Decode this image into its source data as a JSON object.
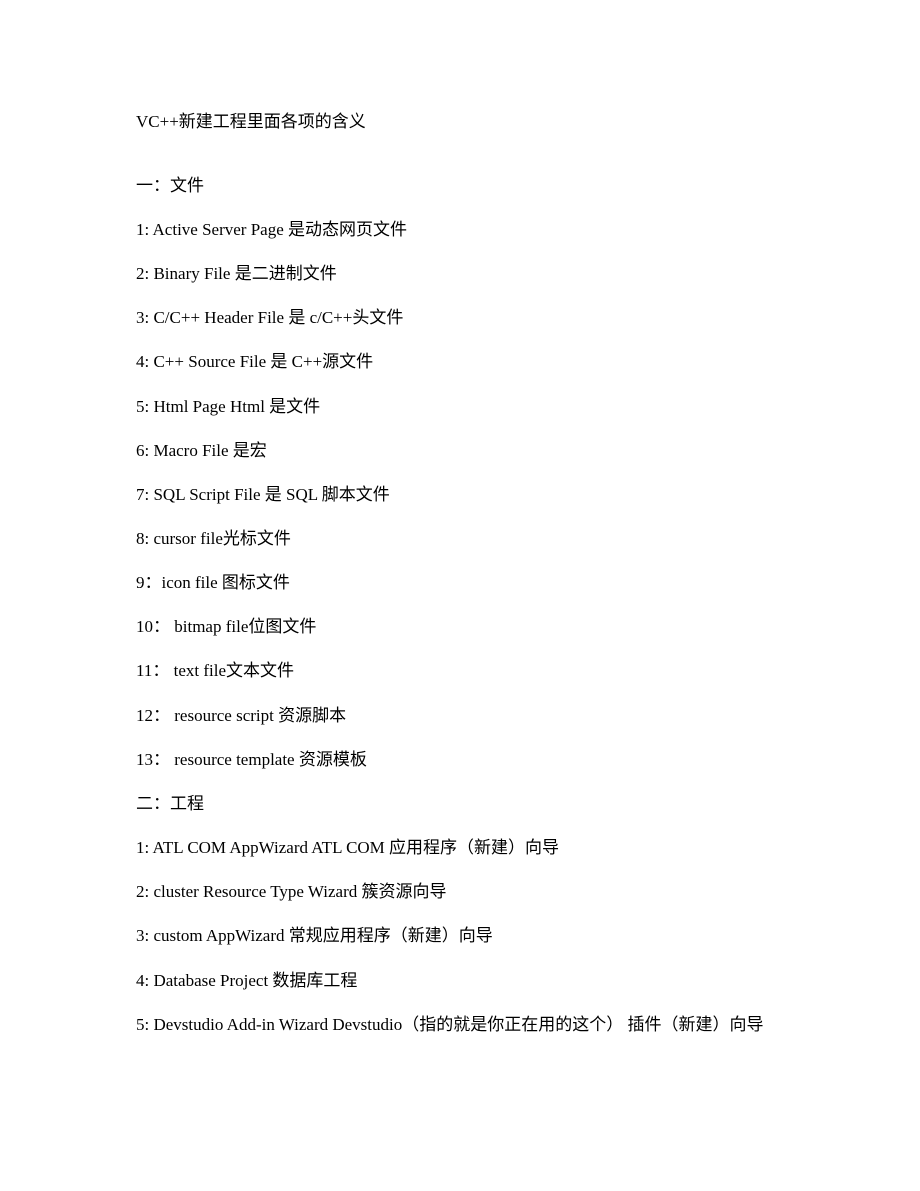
{
  "document": {
    "title": "VC++新建工程里面各项的含义",
    "sections": [
      {
        "heading": "一：文件",
        "items": [
          "1: Active Server Page 是动态网页文件",
          "2: Binary File 是二进制文件",
          "3: C/C++ Header File 是 c/C++头文件",
          "4: C++ Source File 是 C++源文件",
          "5: Html Page Html 是文件",
          "6: Macro File 是宏",
          "7: SQL Script File 是 SQL 脚本文件",
          "8: cursor file光标文件",
          "9：icon file 图标文件",
          "10：  bitmap file位图文件",
          "11：  text file文本文件",
          "12：  resource script 资源脚本",
          "13：  resource template 资源模板"
        ]
      },
      {
        "heading": "二：工程",
        "items": [
          "1: ATL COM AppWizard ATL COM 应用程序（新建）向导",
          "2: cluster Resource Type Wizard 簇资源向导",
          "3: custom AppWizard 常规应用程序（新建）向导",
          "4: Database Project 数据库工程",
          "5: Devstudio Add-in Wizard Devstudio（指的就是你正在用的这个） 插件（新建）向导"
        ]
      }
    ]
  }
}
